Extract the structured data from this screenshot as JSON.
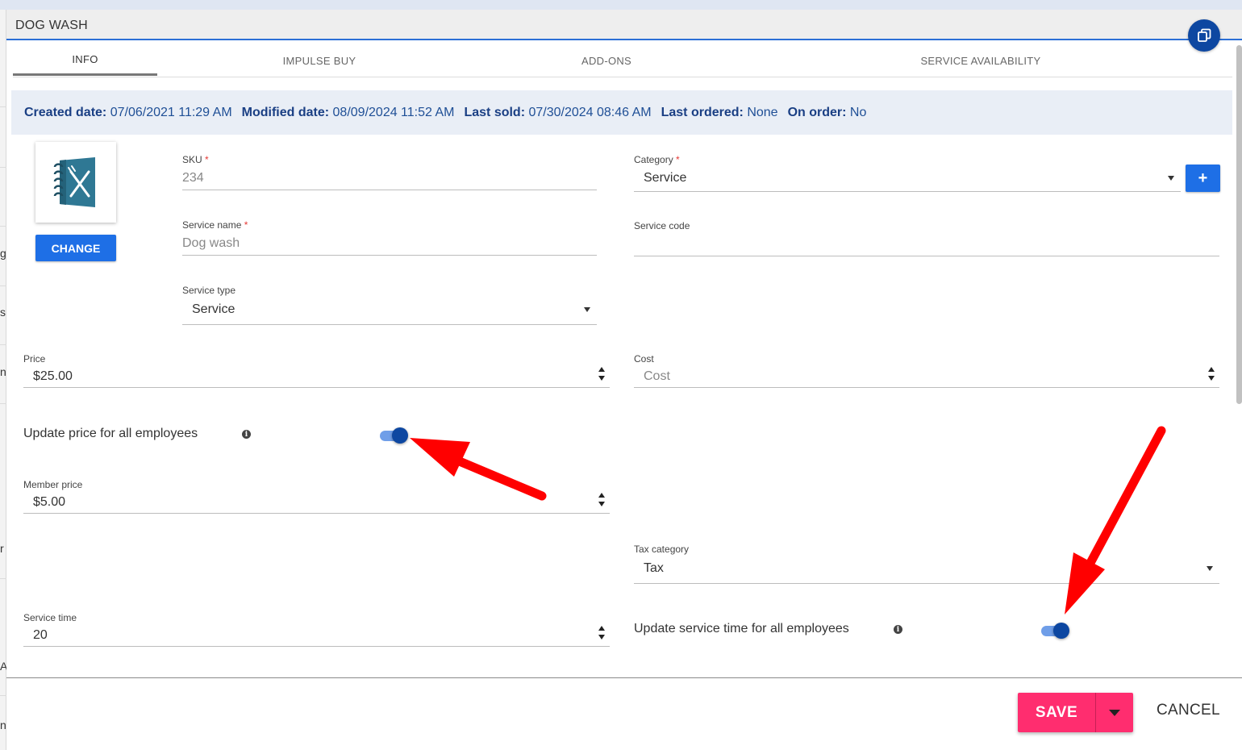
{
  "dialog": {
    "title": "DOG WASH"
  },
  "background_page": {
    "fragments": [
      "g",
      "s",
      "n",
      "r",
      "A",
      "n"
    ]
  },
  "tabs": [
    {
      "label": "INFO",
      "active": true
    },
    {
      "label": "IMPULSE BUY",
      "active": false
    },
    {
      "label": "ADD-ONS",
      "active": false
    },
    {
      "label": "SERVICE AVAILABILITY",
      "active": false
    }
  ],
  "info_bar": {
    "created_label": "Created date:",
    "created_value": "07/06/2021 11:29 AM",
    "modified_label": "Modified date:",
    "modified_value": "08/09/2024 11:52 AM",
    "last_sold_label": "Last sold:",
    "last_sold_value": "07/30/2024 08:46 AM",
    "last_ordered_label": "Last ordered:",
    "last_ordered_value": "None",
    "on_order_label": "On order:",
    "on_order_value": "No"
  },
  "image": {
    "icon": "notebook-fork-knife-icon",
    "change_label": "CHANGE"
  },
  "form": {
    "sku": {
      "label": "SKU",
      "required": "*",
      "value": "234"
    },
    "category": {
      "label": "Category",
      "required": "*",
      "value": "Service",
      "add_label": "+"
    },
    "service_name": {
      "label": "Service name",
      "required": "*",
      "value": "Dog wash"
    },
    "service_code": {
      "label": "Service code",
      "value": ""
    },
    "service_type": {
      "label": "Service type",
      "value": "Service"
    },
    "price": {
      "label": "Price",
      "value": "$25.00"
    },
    "cost": {
      "label": "Cost",
      "placeholder": "Cost"
    },
    "update_price": {
      "label": "Update price for all employees",
      "info": "i",
      "enabled": true
    },
    "member_price": {
      "label": "Member price",
      "value": "$5.00"
    },
    "tax_category": {
      "label": "Tax category",
      "value": "Tax"
    },
    "service_time": {
      "label": "Service time",
      "value": "20"
    },
    "update_service_time": {
      "label": "Update service time for all employees",
      "info": "i",
      "enabled": true
    }
  },
  "footer": {
    "save_label": "SAVE",
    "cancel_label": "CANCEL"
  },
  "colors": {
    "accent_blue": "#1e6fe6",
    "dark_blue": "#0d47a1",
    "save_pink": "#ff2d6f",
    "annotation_red": "#ff0000",
    "info_bar_bg": "#e9eef6"
  }
}
